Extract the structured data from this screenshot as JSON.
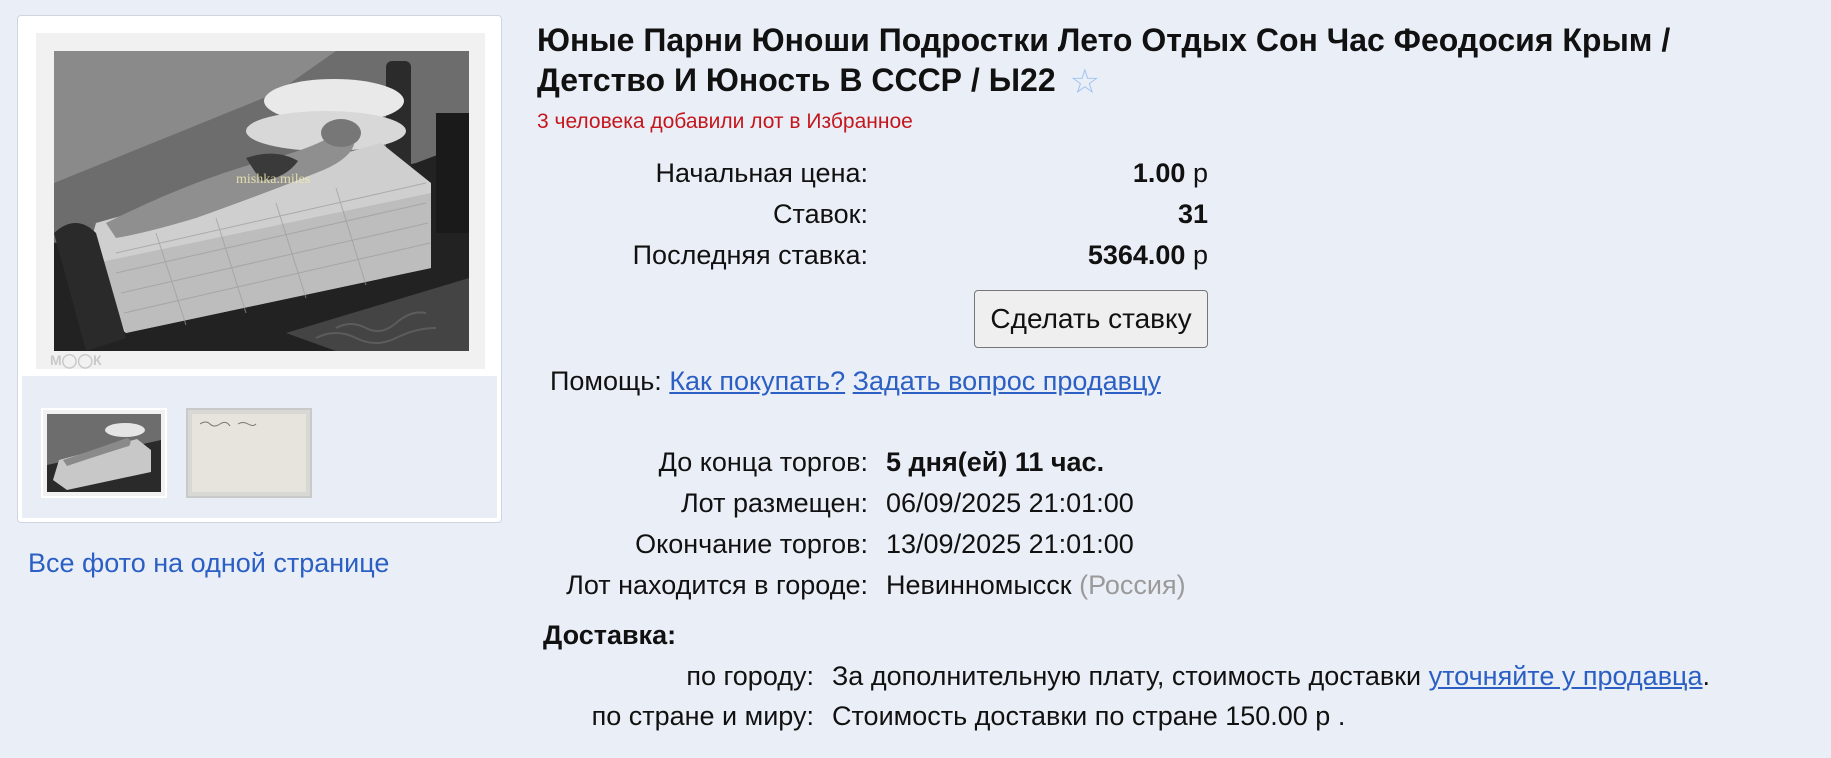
{
  "lot": {
    "title": "Юные Парни Юноши Подростки Лето Отдых Сон Час Феодосия Крым / Детство И Юность В СССР / Ы22",
    "favorites_note": "3 человека добавили лот в Избранное"
  },
  "gallery": {
    "watermark": "mishka.miles",
    "all_photos_label": "Все фото на одной странице"
  },
  "price": {
    "start_label": "Начальная цена:",
    "start_value": "1.00",
    "currency": "р",
    "bids_label": "Ставок:",
    "bids_value": "31",
    "last_label": "Последняя ставка:",
    "last_value": "5364.00"
  },
  "actions": {
    "bid_button": "Сделать ставку"
  },
  "help": {
    "label": "Помощь:",
    "how_to_buy": "Как покупать?",
    "ask_seller": "Задать вопрос продавцу"
  },
  "timing": {
    "ends_in_label": "До конца торгов:",
    "ends_in_value": "5 дня(ей) 11 час.",
    "posted_label": "Лот размещен:",
    "posted_value": "06/09/2025 21:01:00",
    "end_label": "Окончание торгов:",
    "end_value": "13/09/2025 21:01:00",
    "city_label": "Лот находится в городе:",
    "city_value": "Невинномысск",
    "country_value": "(Россия)"
  },
  "delivery": {
    "heading": "Доставка:",
    "city_label": "по городу:",
    "city_text": "За дополнительную плату, стоимость доставки",
    "city_link": "уточняйте у продавца",
    "city_suffix": ".",
    "country_label": "по стране и миру:",
    "country_text": "Стоимость доставки по стране 150.00 р ."
  },
  "colors": {
    "background": "#eaeff7",
    "link": "#2b5fc4",
    "alert": "#c4161c"
  }
}
